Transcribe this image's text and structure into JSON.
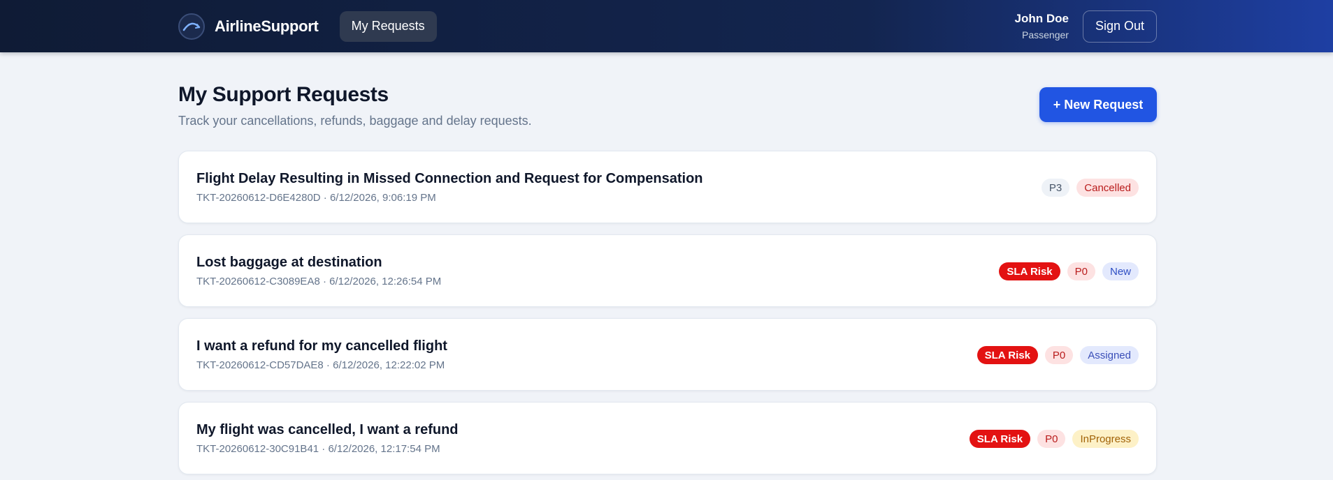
{
  "header": {
    "brand_name": "AirlineSupport",
    "logo_icon": "plane-arc-icon",
    "nav_link": "My Requests",
    "user_name": "John Doe",
    "user_role": "Passenger",
    "signout_label": "Sign Out"
  },
  "page": {
    "title": "My Support Requests",
    "subtitle": "Track your cancellations, refunds, baggage and delay requests.",
    "new_request_label": "+ New Request"
  },
  "tickets": [
    {
      "title": "Flight Delay Resulting in Missed Connection and Request for Compensation",
      "meta": "TKT-20260612-D6E4280D · 6/12/2026, 9:06:19 PM",
      "sla": "",
      "priority": "P3",
      "status": "Cancelled"
    },
    {
      "title": "Lost baggage at destination",
      "meta": "TKT-20260612-C3089EA8 · 6/12/2026, 12:26:54 PM",
      "sla": "SLA Risk",
      "priority": "P0",
      "status": "New"
    },
    {
      "title": "I want a refund for my cancelled flight",
      "meta": "TKT-20260612-CD57DAE8 · 6/12/2026, 12:22:02 PM",
      "sla": "SLA Risk",
      "priority": "P0",
      "status": "Assigned"
    },
    {
      "title": "My flight was cancelled, I want a refund",
      "meta": "TKT-20260612-30C91B41 · 6/12/2026, 12:17:54 PM",
      "sla": "SLA Risk",
      "priority": "P0",
      "status": "InProgress"
    }
  ],
  "colors": {
    "primary": "#2155e3",
    "navbar_dark": "#0f1b35",
    "navbar_accent": "#1e3fa3",
    "sla_risk": "#e31212",
    "background": "#f0f3f8"
  }
}
